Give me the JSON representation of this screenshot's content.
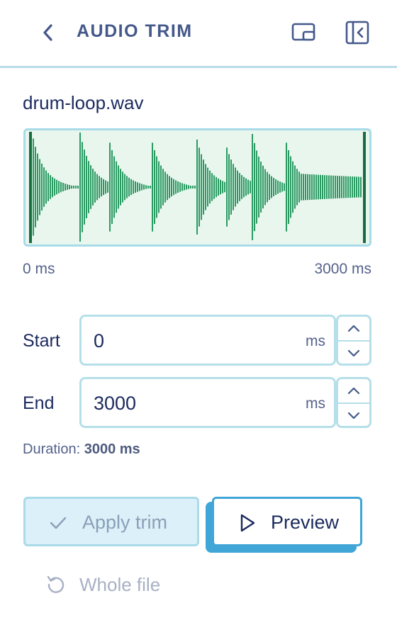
{
  "header": {
    "title": "AUDIO TRIM",
    "back_icon": "chevron-left-icon",
    "pip_icon": "picture-in-picture-icon",
    "collapse_icon": "sidebar-collapse-icon"
  },
  "file": {
    "name": "drum-loop.wav"
  },
  "waveform": {
    "range_start_label": "0 ms",
    "range_end_label": "3000 ms",
    "colors": {
      "background": "#e9f6ee",
      "wave": "#2a9a62",
      "handle": "#1a6b3f",
      "border": "#a7dbe7"
    }
  },
  "start": {
    "label": "Start",
    "value": "0",
    "unit": "ms"
  },
  "end": {
    "label": "End",
    "value": "3000",
    "unit": "ms"
  },
  "duration": {
    "label": "Duration:",
    "value": "3000 ms"
  },
  "actions": {
    "apply_label": "Apply trim",
    "apply_icon": "check-icon",
    "preview_label": "Preview",
    "preview_icon": "play-icon",
    "whole_file_label": "Whole file",
    "whole_file_icon": "reset-icon"
  },
  "colors": {
    "accent": "#3fa6d7",
    "text": "#1b2a5e",
    "muted": "#55618c"
  }
}
